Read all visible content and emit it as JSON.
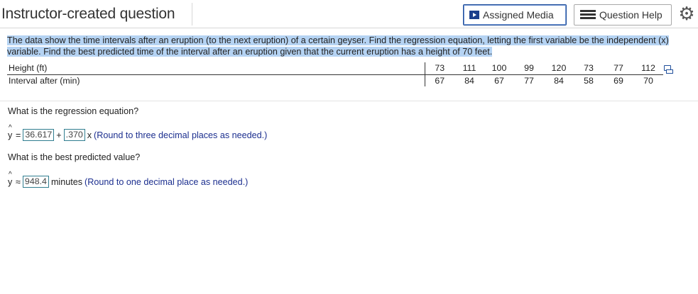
{
  "header": {
    "title": "Instructor-created question",
    "assigned_media_label": "Assigned Media",
    "question_help_label": "Question Help"
  },
  "question": {
    "text_before": "The data show the time intervals after an eruption (to the next eruption) of a certain geyser. Find the regression equation, letting the first variable be the independent (x) variable. Find the best predicted time of the interval after an eruption given that the current eruption has a height of ",
    "height_value": "70",
    "text_after": " feet."
  },
  "table": {
    "row1_label": "Height (ft)",
    "row2_label": "Interval after (min)",
    "heights": [
      "73",
      "111",
      "100",
      "99",
      "120",
      "73",
      "77",
      "112"
    ],
    "intervals": [
      "67",
      "84",
      "67",
      "77",
      "84",
      "58",
      "69",
      "70"
    ]
  },
  "part1": {
    "prompt": "What is the regression equation?",
    "y_prefix": "y =",
    "intercept": "36.617",
    "plus": "+",
    "slope": ".370",
    "x_suffix": "x",
    "hint": "(Round to three decimal places as needed.)"
  },
  "part2": {
    "prompt": "What is the best predicted value?",
    "y_prefix": "y ≈",
    "value": "948.4",
    "units": "minutes",
    "hint": "(Round to one decimal place as needed.)"
  }
}
